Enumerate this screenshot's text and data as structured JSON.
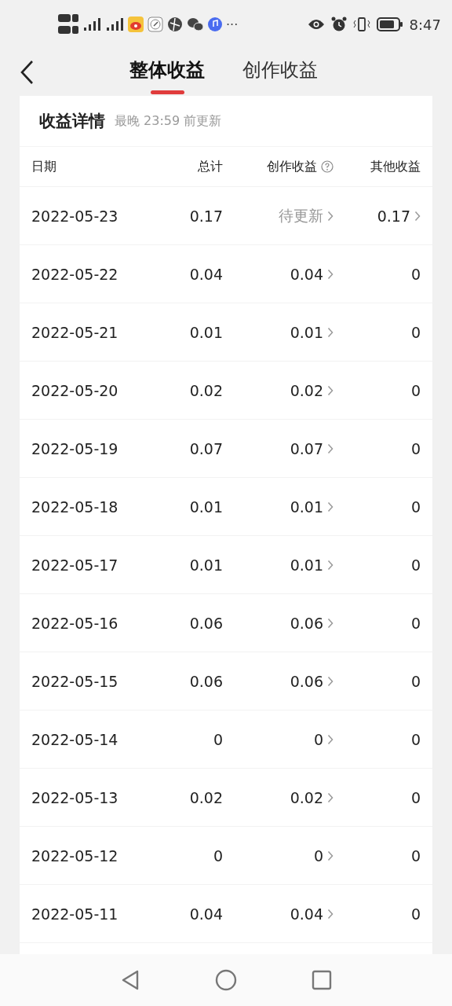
{
  "status_bar": {
    "more": "···",
    "time": "8:47"
  },
  "tabs": [
    {
      "label": "整体收益",
      "selected": true
    },
    {
      "label": "创作收益",
      "selected": false
    }
  ],
  "card": {
    "title": "收益详情",
    "note": "最晚 23:59 前更新"
  },
  "table": {
    "columns": [
      {
        "label": "日期",
        "help": false
      },
      {
        "label": "总计",
        "help": false
      },
      {
        "label": "创作收益",
        "help": true
      },
      {
        "label": "其他收益",
        "help": false
      }
    ],
    "rows": [
      {
        "date": "2022-05-23",
        "total": "0.17",
        "creation": {
          "text": "待更新",
          "pending": true,
          "link": true
        },
        "other": {
          "text": "0.17",
          "link": true
        }
      },
      {
        "date": "2022-05-22",
        "total": "0.04",
        "creation": {
          "text": "0.04",
          "pending": false,
          "link": true
        },
        "other": {
          "text": "0",
          "link": false
        }
      },
      {
        "date": "2022-05-21",
        "total": "0.01",
        "creation": {
          "text": "0.01",
          "pending": false,
          "link": true
        },
        "other": {
          "text": "0",
          "link": false
        }
      },
      {
        "date": "2022-05-20",
        "total": "0.02",
        "creation": {
          "text": "0.02",
          "pending": false,
          "link": true
        },
        "other": {
          "text": "0",
          "link": false
        }
      },
      {
        "date": "2022-05-19",
        "total": "0.07",
        "creation": {
          "text": "0.07",
          "pending": false,
          "link": true
        },
        "other": {
          "text": "0",
          "link": false
        }
      },
      {
        "date": "2022-05-18",
        "total": "0.01",
        "creation": {
          "text": "0.01",
          "pending": false,
          "link": true
        },
        "other": {
          "text": "0",
          "link": false
        }
      },
      {
        "date": "2022-05-17",
        "total": "0.01",
        "creation": {
          "text": "0.01",
          "pending": false,
          "link": true
        },
        "other": {
          "text": "0",
          "link": false
        }
      },
      {
        "date": "2022-05-16",
        "total": "0.06",
        "creation": {
          "text": "0.06",
          "pending": false,
          "link": true
        },
        "other": {
          "text": "0",
          "link": false
        }
      },
      {
        "date": "2022-05-15",
        "total": "0.06",
        "creation": {
          "text": "0.06",
          "pending": false,
          "link": true
        },
        "other": {
          "text": "0",
          "link": false
        }
      },
      {
        "date": "2022-05-14",
        "total": "0",
        "creation": {
          "text": "0",
          "pending": false,
          "link": true
        },
        "other": {
          "text": "0",
          "link": false
        }
      },
      {
        "date": "2022-05-13",
        "total": "0.02",
        "creation": {
          "text": "0.02",
          "pending": false,
          "link": true
        },
        "other": {
          "text": "0",
          "link": false
        }
      },
      {
        "date": "2022-05-12",
        "total": "0",
        "creation": {
          "text": "0",
          "pending": false,
          "link": true
        },
        "other": {
          "text": "0",
          "link": false
        }
      },
      {
        "date": "2022-05-11",
        "total": "0.04",
        "creation": {
          "text": "0.04",
          "pending": false,
          "link": true
        },
        "other": {
          "text": "0",
          "link": false
        }
      }
    ]
  }
}
